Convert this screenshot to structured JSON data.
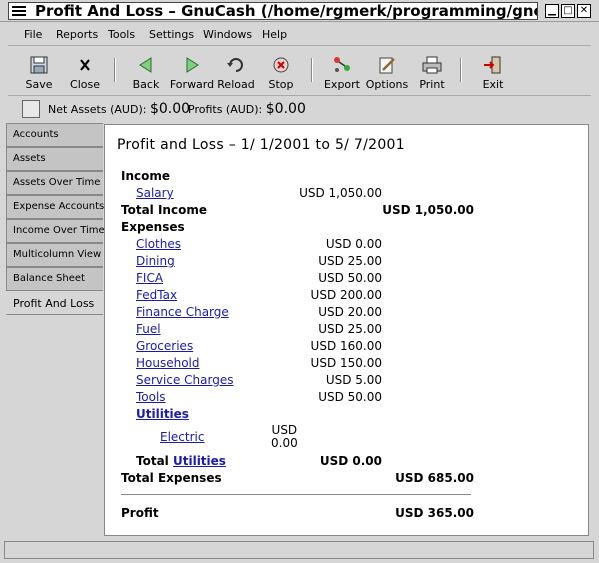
{
  "window": {
    "title": "Profit And Loss – GnuCash (/home/rgmerk/programming/gnc/c"
  },
  "menubar": {
    "items": [
      {
        "label": "File"
      },
      {
        "label": "Reports"
      },
      {
        "label": "Tools"
      },
      {
        "label": "Settings"
      },
      {
        "label": "Windows"
      },
      {
        "label": "Help"
      }
    ]
  },
  "toolbar": {
    "buttons": [
      {
        "label": "Save",
        "icon": "save-icon"
      },
      {
        "label": "Close",
        "icon": "close-icon"
      },
      {
        "label": "Back",
        "icon": "back-arrow-icon"
      },
      {
        "label": "Forward",
        "icon": "forward-arrow-icon"
      },
      {
        "label": "Reload",
        "icon": "reload-icon"
      },
      {
        "label": "Stop",
        "icon": "stop-icon"
      },
      {
        "label": "Export",
        "icon": "export-icon"
      },
      {
        "label": "Options",
        "icon": "options-icon"
      },
      {
        "label": "Print",
        "icon": "printer-icon"
      },
      {
        "label": "Exit",
        "icon": "exit-icon"
      }
    ]
  },
  "summary": {
    "net_assets_label": "Net Assets (AUD):",
    "net_assets_value": "$0.00",
    "profits_label": "Profits (AUD):",
    "profits_value": "$0.00"
  },
  "tabs": [
    {
      "label": "Accounts"
    },
    {
      "label": "Assets"
    },
    {
      "label": "Assets Over Time"
    },
    {
      "label": "Expense Accounts"
    },
    {
      "label": "Income Over Time"
    },
    {
      "label": "Multicolumn View"
    },
    {
      "label": "Balance Sheet"
    },
    {
      "label": "Profit And Loss"
    }
  ],
  "report": {
    "title": "Profit and Loss – 1/ 1/2001 to 5/ 7/2001",
    "income_heading": "Income",
    "salary": {
      "label": "Salary",
      "value": "USD 1,050.00"
    },
    "total_income": {
      "label": "Total Income",
      "value": "USD 1,050.00"
    },
    "expenses_heading": "Expenses",
    "expenses": [
      {
        "label": "Clothes",
        "value": "USD 0.00"
      },
      {
        "label": "Dining",
        "value": "USD 25.00"
      },
      {
        "label": "FICA",
        "value": "USD 50.00"
      },
      {
        "label": "FedTax",
        "value": "USD 200.00"
      },
      {
        "label": "Finance Charge",
        "value": "USD 20.00"
      },
      {
        "label": "Fuel",
        "value": "USD 25.00"
      },
      {
        "label": "Groceries",
        "value": "USD 160.00"
      },
      {
        "label": "Household",
        "value": "USD 150.00"
      },
      {
        "label": "Service Charges",
        "value": "USD 5.00"
      },
      {
        "label": "Tools",
        "value": "USD 50.00"
      }
    ],
    "utilities": {
      "label": "Utilities"
    },
    "electric": {
      "label": "Electric",
      "value_line1": "USD",
      "value_line2": "0.00"
    },
    "total_utilities": {
      "prefix": "Total",
      "label": "Utilities",
      "value": "USD 0.00"
    },
    "total_expenses": {
      "label": "Total Expenses",
      "value": "USD 685.00"
    },
    "profit": {
      "label": "Profit",
      "value": "USD 365.00"
    }
  }
}
